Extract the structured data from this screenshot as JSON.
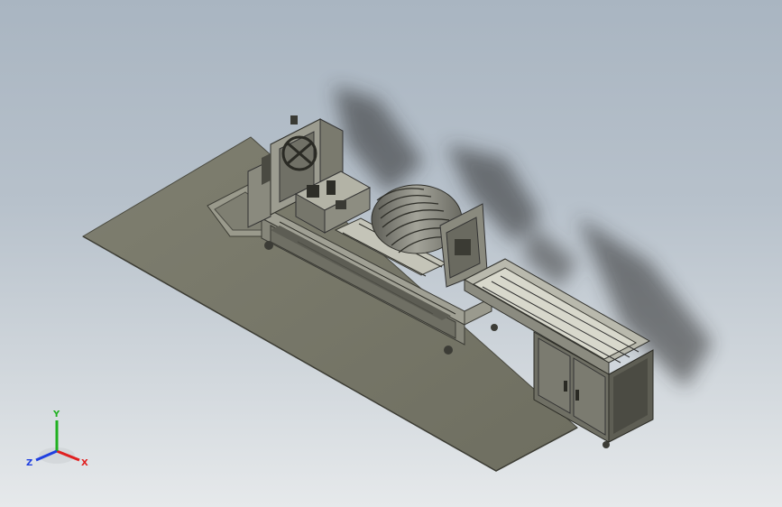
{
  "viewport": {
    "background_top": "#a9b5c1",
    "background_bottom": "#e6e9eb"
  },
  "model": {
    "floor_color": "#7b7b6b",
    "frame_color": "#8e8e80",
    "frame_dark": "#5a5a50",
    "shadow_color": "#2a2a2a",
    "drum_color": "#8a8a80"
  },
  "triad": {
    "x_label": "X",
    "y_label": "Y",
    "z_label": "Z",
    "x_color": "#e02020",
    "y_color": "#20b020",
    "z_color": "#2040e0"
  }
}
